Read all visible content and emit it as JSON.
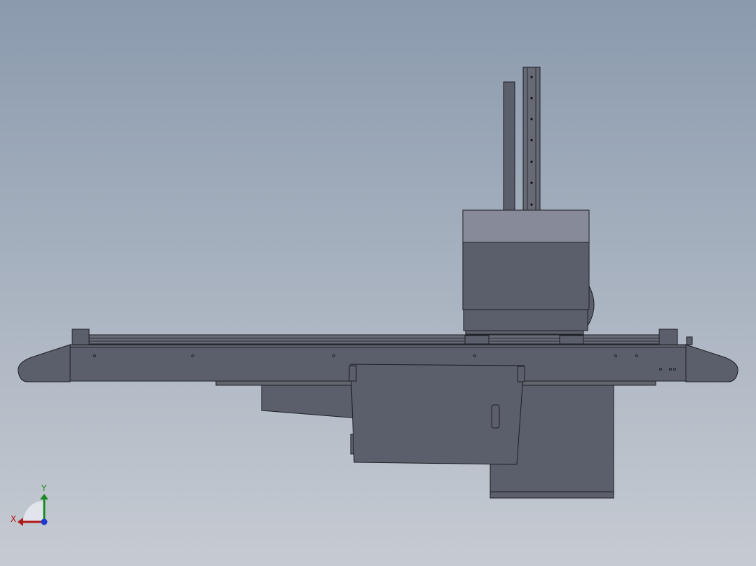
{
  "viewport": {
    "colors": {
      "bg_top": "#8b9aae",
      "bg_bottom": "#c6cbd2",
      "body_dark": "#5b5f6b",
      "body_mid": "#666a75",
      "body_light": "#878a99",
      "edge": "#1c1e24",
      "detail": "#2a2c33"
    }
  },
  "triad": {
    "x_label": "X",
    "y_label": "Y",
    "x_color": "#b01818",
    "y_color": "#1a8a24",
    "z_color": "#1c3ad0"
  }
}
